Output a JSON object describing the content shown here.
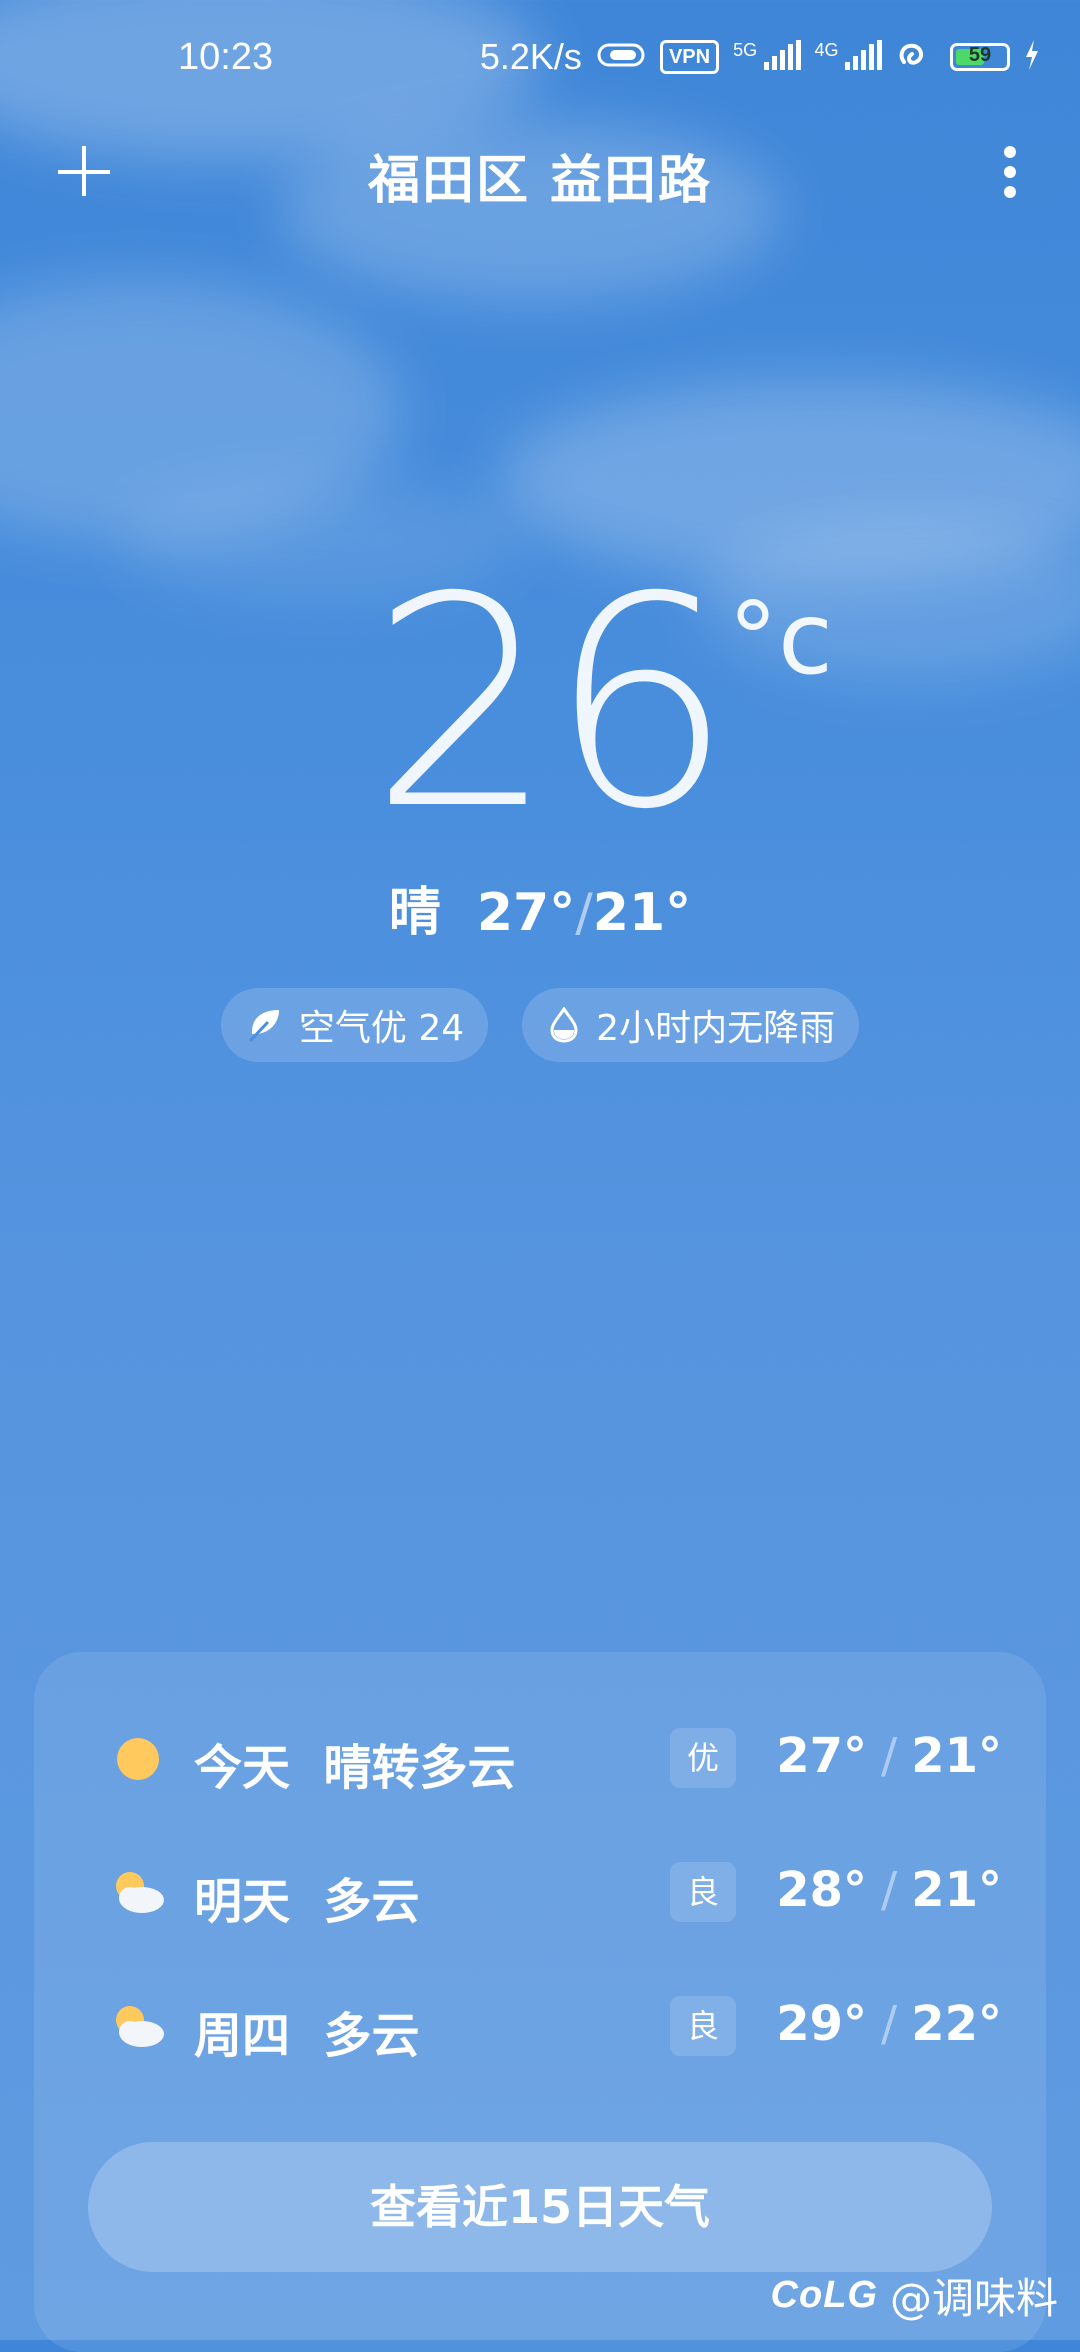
{
  "status_bar": {
    "time": "10:23",
    "net_speed": "5.2K/s",
    "vpn": "VPN",
    "sim1_label": "5G",
    "sim2_label": "4G",
    "battery_level": "59",
    "battery_fraction": 0.59,
    "charging": true
  },
  "header": {
    "location": "福田区 益田路"
  },
  "current": {
    "temperature": "26",
    "unit": "°c",
    "condition": "晴",
    "high": "27°",
    "separator": "/",
    "low": "21°"
  },
  "chips": {
    "air_quality": "空气优 24",
    "rain": "2小时内无降雨"
  },
  "forecast": [
    {
      "day": "今天",
      "condition": "晴转多云",
      "aqi": "优",
      "high": "27°",
      "low": "21°",
      "icon": "sun-icon"
    },
    {
      "day": "明天",
      "condition": "多云",
      "aqi": "良",
      "high": "28°",
      "low": "21°",
      "icon": "partly-cloudy-icon"
    },
    {
      "day": "周四",
      "condition": "多云",
      "aqi": "良",
      "high": "29°",
      "low": "22°",
      "icon": "partly-cloudy-icon"
    }
  ],
  "forecast_button": "查看近15日天气",
  "watermark": {
    "logo": "CoLG",
    "handle": "@调味料"
  },
  "colors": {
    "sky_top": "#3f86d8",
    "sky_bottom": "#5f9be0",
    "sun": "#ffc95e",
    "battery": "#4cd96a"
  }
}
